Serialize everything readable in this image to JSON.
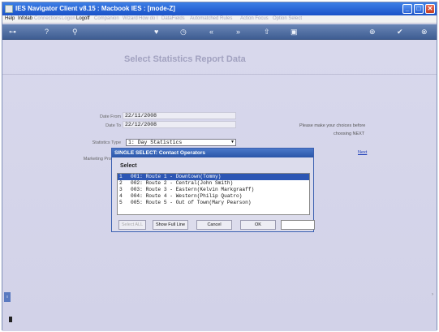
{
  "window": {
    "title": "IES Navigator Client v8.15 : Macbook IES :      [mode-Z]"
  },
  "menu": {
    "items": [
      {
        "label": "Help",
        "enabled": true
      },
      {
        "label": "Infolab",
        "enabled": true
      },
      {
        "label": "Connections",
        "enabled": false
      },
      {
        "label": "Logon",
        "enabled": false
      },
      {
        "label": "Logoff",
        "enabled": true
      },
      {
        "label": "Companion",
        "enabled": false
      },
      {
        "label": "Wizard",
        "enabled": false
      },
      {
        "label": "How do I",
        "enabled": false
      },
      {
        "label": "DataFields",
        "enabled": false
      },
      {
        "label": "Automatched Rules",
        "enabled": false
      },
      {
        "label": "Action Focus",
        "enabled": false
      },
      {
        "label": "Option Select",
        "enabled": false
      }
    ]
  },
  "toolbar": {
    "icons": [
      "key-icon",
      "help-icon",
      "search-icon",
      "heart-icon",
      "clock-icon",
      "back-icon",
      "forward-icon",
      "bookmark-icon",
      "paste-icon",
      "add-icon",
      "check-icon",
      "cancel-icon"
    ]
  },
  "page": {
    "heading": "Select Statistics Report Data",
    "date_from_label": "Date From",
    "date_from_value": "22/11/2008",
    "date_to_label": "Date To",
    "date_to_value": "22/12/2008",
    "statistics_type_label": "Statistics Type",
    "statistics_type_value": "1: Day Statistics",
    "marketing_label": "Marketing Pro",
    "hint_line1": "Please make your choices before",
    "hint_line2": "choosing NEXT",
    "next_link": "Next"
  },
  "dialog": {
    "title": "SINGLE SELECT: Contact Operators",
    "subtitle": "Select",
    "rows": [
      {
        "num": "1",
        "text": "001: Route 1 - Downtown(Tommy)",
        "selected": true
      },
      {
        "num": "2",
        "text": "002: Route 2 - Central(John Smith)",
        "selected": false
      },
      {
        "num": "3",
        "text": "003: Route 3 - Eastern(Kelvin Markgraaff)",
        "selected": false
      },
      {
        "num": "4",
        "text": "004: Route 4 - Western(Philip Quatro)",
        "selected": false
      },
      {
        "num": "5",
        "text": "005: Route 5 - Out of Town(Mary Pearson)",
        "selected": false
      }
    ],
    "buttons": {
      "select_all": "Select ALL",
      "show_full_line": "Show Full Line",
      "cancel": "Cancel",
      "ok": "OK"
    },
    "search_value": ""
  }
}
